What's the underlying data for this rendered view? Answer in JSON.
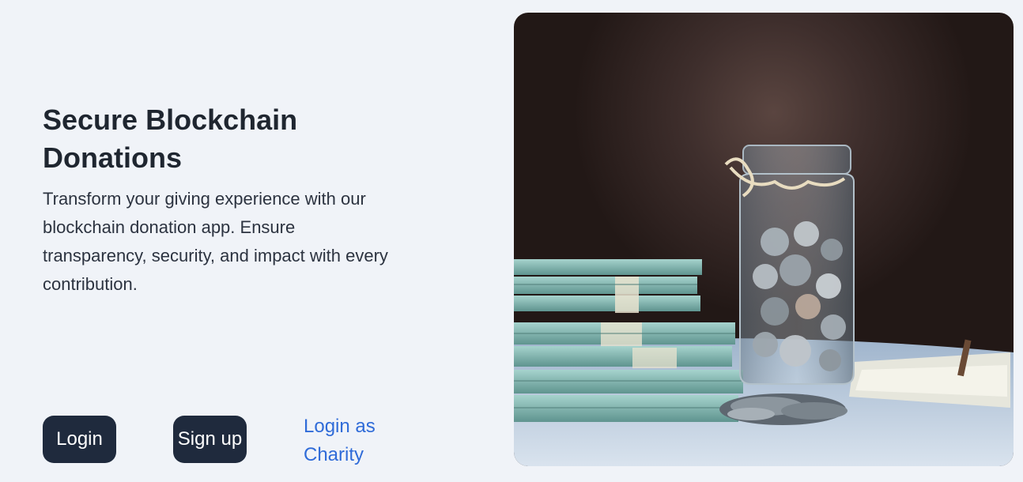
{
  "hero": {
    "title": "Secure Blockchain Donations",
    "description": "Transform your giving experience with our blockchain donation app. Ensure transparency, security, and impact with every contribution."
  },
  "actions": {
    "login_label": "Login",
    "signup_label": "Sign up",
    "charity_login_label": "Login as Charity"
  },
  "image": {
    "subject": "coin-jar-and-banknote-stacks"
  },
  "colors": {
    "background": "#f0f3f8",
    "button": "#1f2a3d",
    "link": "#2f6bd8",
    "text": "#1f2630"
  }
}
